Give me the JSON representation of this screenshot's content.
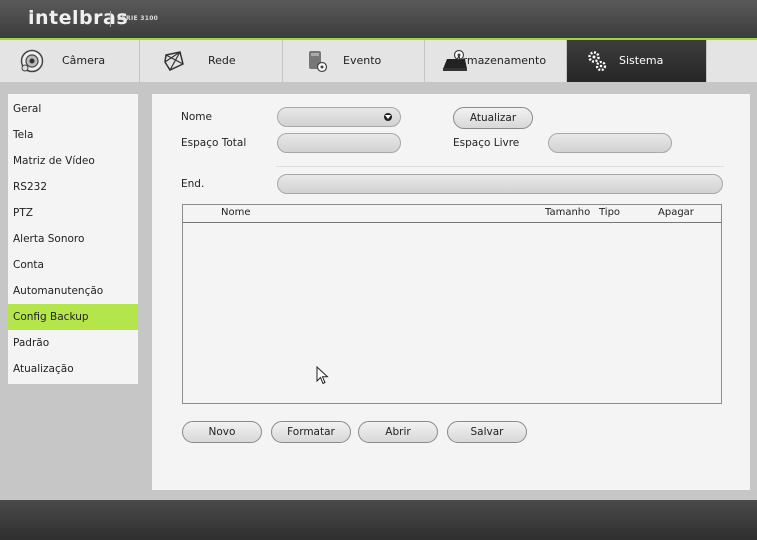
{
  "header": {
    "brand": "intelbras",
    "series": "SÉRIE 3100"
  },
  "tabs": [
    {
      "label": "Câmera",
      "icon": "camera-icon"
    },
    {
      "label": "Rede",
      "icon": "network-icon"
    },
    {
      "label": "Evento",
      "icon": "event-icon"
    },
    {
      "label": "Armazenamento",
      "icon": "storage-icon"
    },
    {
      "label": "Sistema",
      "icon": "gear-icon",
      "active": true
    }
  ],
  "sidebar": {
    "items": [
      {
        "label": "Geral"
      },
      {
        "label": "Tela"
      },
      {
        "label": "Matriz de Vídeo"
      },
      {
        "label": "RS232"
      },
      {
        "label": "PTZ"
      },
      {
        "label": "Alerta Sonoro"
      },
      {
        "label": "Conta"
      },
      {
        "label": "Automanutenção"
      },
      {
        "label": "Config Backup",
        "active": true
      },
      {
        "label": "Padrão"
      },
      {
        "label": "Atualização"
      }
    ],
    "active_color": "#b4e64c"
  },
  "form": {
    "nome_label": "Nome",
    "nome_value": "",
    "atualizar_label": "Atualizar",
    "espaco_total_label": "Espaço Total",
    "espaco_total_value": "",
    "espaco_livre_label": "Espaço Livre",
    "espaco_livre_value": "",
    "end_label": "End.",
    "end_value": ""
  },
  "table": {
    "columns": [
      "Nome",
      "Tamanho",
      "Tipo",
      "Apagar"
    ],
    "rows": []
  },
  "actions": {
    "novo": "Novo",
    "formatar": "Formatar",
    "abrir": "Abrir",
    "salvar": "Salvar"
  }
}
